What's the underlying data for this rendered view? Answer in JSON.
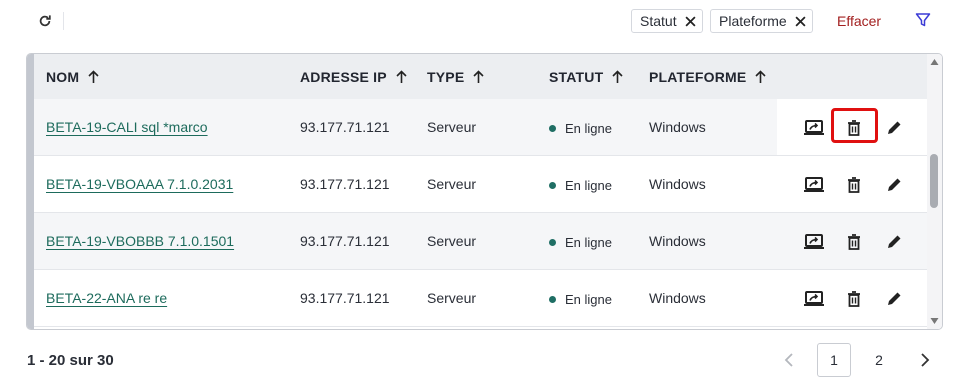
{
  "toolbar": {
    "refresh_icon": "refresh-icon",
    "filters": [
      {
        "label": "Statut"
      },
      {
        "label": "Plateforme"
      }
    ],
    "clear_label": "Effacer",
    "filter_icon": "filter-icon",
    "colors": {
      "clear": "#a32020",
      "filter": "#3b3bd6"
    }
  },
  "table": {
    "columns": [
      "NOM",
      "ADRESSE IP",
      "TYPE",
      "STATUT",
      "PLATEFORME"
    ],
    "sort_icon": "arrow-up-icon",
    "rows": [
      {
        "name": "BETA-19-CALI sql *marco",
        "ip": "93.177.71.121",
        "type": "Serveur",
        "status": "En ligne",
        "platform": "Windows"
      },
      {
        "name": "BETA-19-VBOAAA 7.1.0.2031",
        "ip": "93.177.71.121",
        "type": "Serveur",
        "status": "En ligne",
        "platform": "Windows"
      },
      {
        "name": "BETA-19-VBOBBB 7.1.0.1501",
        "ip": "93.177.71.121",
        "type": "Serveur",
        "status": "En ligne",
        "platform": "Windows"
      },
      {
        "name": "BETA-22-ANA re re",
        "ip": "93.177.71.121",
        "type": "Serveur",
        "status": "En ligne",
        "platform": "Windows"
      }
    ],
    "row_actions": [
      "remote-screen-icon",
      "trash-icon",
      "pencil-icon"
    ],
    "colors": {
      "link": "#1d6b5c",
      "status_online": "#1f6e64",
      "highlight": "#e01010"
    }
  },
  "pagination": {
    "summary": "1 - 20 sur 30",
    "pages": [
      "1",
      "2"
    ],
    "current_page": "1"
  }
}
